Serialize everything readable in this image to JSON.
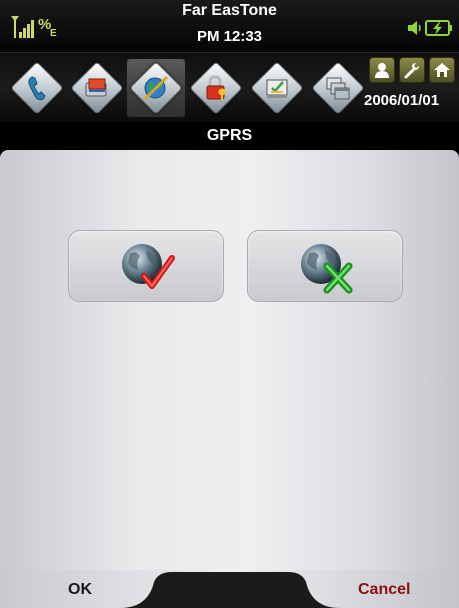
{
  "status_bar": {
    "signal_icon": "signal-strength-icon",
    "data_indicator_label": "%E",
    "carrier": "Far EasTone",
    "time": "PM 12:33",
    "speaker_icon": "speaker-icon",
    "battery_icon": "battery-charging-icon"
  },
  "app_bar": {
    "apps": [
      {
        "icon": "phone-handset-icon"
      },
      {
        "icon": "card-reader-icon"
      },
      {
        "icon": "globe-network-icon",
        "selected": true
      },
      {
        "icon": "lock-key-icon"
      },
      {
        "icon": "checklist-icon"
      },
      {
        "icon": "window-stack-icon"
      }
    ],
    "quick_buttons": [
      "user-icon",
      "wrench-icon",
      "home-icon"
    ],
    "date": "2006/01/01"
  },
  "title": "GPRS",
  "options": [
    {
      "icon": "globe-check-icon",
      "meaning": "connect"
    },
    {
      "icon": "globe-x-icon",
      "meaning": "disconnect"
    }
  ],
  "softkeys": {
    "ok": "OK",
    "cancel": "Cancel"
  },
  "colors": {
    "cancel_text": "#8a1010",
    "check_mark": "#d01818",
    "x_mark": "#2fbf2f",
    "quick_button": "#6e7030"
  }
}
